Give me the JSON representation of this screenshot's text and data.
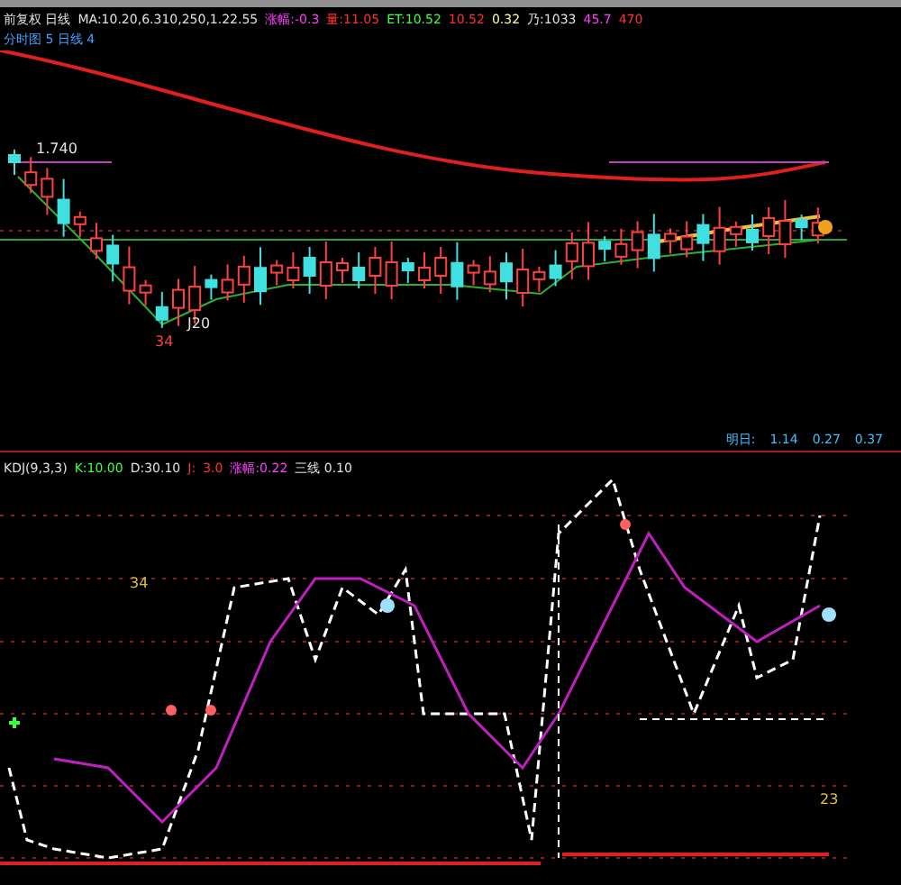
{
  "main_panel": {
    "header": [
      {
        "text": "前复权 日线",
        "color": "#e0e0e0"
      },
      {
        "text": "MA:10.20,6.310,250,1.22.55",
        "color": "#e0e0e0"
      },
      {
        "text": "涨幅:-0.3",
        "color": "#ff40ff"
      },
      {
        "text": "量:11.05",
        "color": "#ff3030"
      },
      {
        "text": "ET:10.52",
        "color": "#40ff40"
      },
      {
        "text": "10.52",
        "color": "#ff3030"
      },
      {
        "text": "0.32",
        "color": "#ffffa0"
      },
      {
        "text": "乃:1033",
        "color": "#e0e0e0"
      },
      {
        "text": "45.7",
        "color": "#ff40ff"
      },
      {
        "text": "470",
        "color": "#ff3030"
      }
    ],
    "subheader": "分时图 5 日线 4",
    "labels": [
      {
        "kind": "price",
        "text": "1.740"
      },
      {
        "kind": "low",
        "text": "J20"
      },
      {
        "kind": "mark",
        "text": "34"
      }
    ],
    "readings": [
      {
        "text": "明日:",
        "color": "#40c0ff"
      },
      {
        "text": "1.14",
        "color": "#40c0ff"
      },
      {
        "text": "0.27",
        "color": "#40c0ff"
      },
      {
        "text": "0.37",
        "color": "#40c0ff"
      }
    ]
  },
  "indicator_panel": {
    "header": [
      {
        "text": "KDJ(9,3,3)",
        "color": "#e0e0e0"
      },
      {
        "text": "K:10.00",
        "color": "#40ff40"
      },
      {
        "text": "D:30.10",
        "color": "#e0e0e0"
      },
      {
        "text": "J:",
        "color": "#ff3030"
      },
      {
        "text": "3.0",
        "color": "#ff3030"
      },
      {
        "text": "涨幅:0.22",
        "color": "#ff40ff"
      },
      {
        "text": "三线 0.10",
        "color": "#e0e0e0"
      }
    ],
    "labels": [
      {
        "kind": "mark",
        "text": "34"
      },
      {
        "kind": "mark",
        "text": "23"
      }
    ]
  }
}
